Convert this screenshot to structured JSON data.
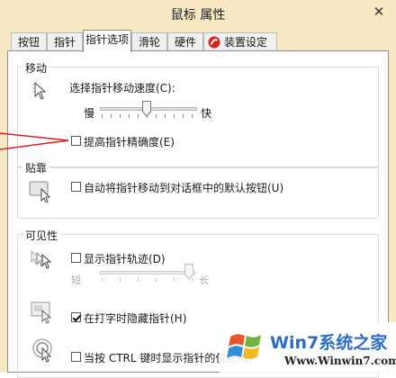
{
  "window": {
    "title": "鼠标 属性",
    "close_glyph": "✕"
  },
  "tabs": [
    {
      "label": "按钮"
    },
    {
      "label": "指针"
    },
    {
      "label": "指针选项"
    },
    {
      "label": "滑轮"
    },
    {
      "label": "硬件"
    },
    {
      "label": "装置设定值"
    }
  ],
  "motion": {
    "title": "移动",
    "speed_label": "选择指针移动速度(C):",
    "slow": "慢",
    "fast": "快",
    "speed_value": 0.5,
    "enhance_label": "提高指针精确度(E)",
    "enhance_checked": false
  },
  "snap": {
    "title": "贴靠",
    "snap_label": "自动将指针移动到对话框中的默认按钮(U)",
    "snap_checked": false
  },
  "visibility": {
    "title": "可见性",
    "trails_label": "显示指针轨迹(D)",
    "trails_checked": false,
    "short": "短",
    "long": "长",
    "trails_value": 1.0,
    "hide_label": "在打字时隐藏指针(H)",
    "hide_checked": true,
    "ctrl_label": "当按 CTRL 键时显示指针的位置(S)",
    "ctrl_checked": false
  },
  "watermark": {
    "brand": "Win7系统之家",
    "url": "Www.Winwin7.com"
  },
  "colors": {
    "title_bar": "#f7e8c2",
    "annotation_arrow": "#e02020",
    "watermark_blue": "#2b6cc4"
  }
}
